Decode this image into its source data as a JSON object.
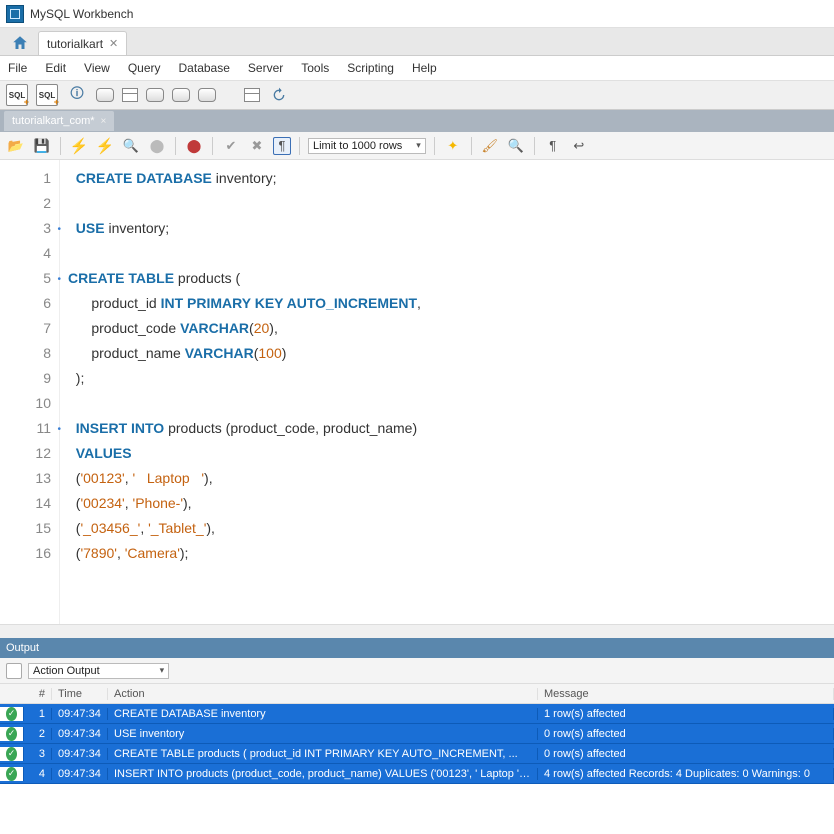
{
  "window": {
    "title": "MySQL Workbench"
  },
  "main_tab": {
    "label": "tutorialkart"
  },
  "menu": [
    "File",
    "Edit",
    "View",
    "Query",
    "Database",
    "Server",
    "Tools",
    "Scripting",
    "Help"
  ],
  "query_tab": {
    "label": "tutorialkart_com*"
  },
  "limit": "Limit to 1000 rows",
  "code": {
    "lines": [
      {
        "n": 1,
        "dot": false,
        "html": "  <span class='kw'>CREATE DATABASE</span> inventory;"
      },
      {
        "n": 2,
        "dot": false,
        "html": ""
      },
      {
        "n": 3,
        "dot": true,
        "html": "  <span class='kw'>USE</span> inventory;"
      },
      {
        "n": 4,
        "dot": false,
        "html": ""
      },
      {
        "n": 5,
        "dot": true,
        "html": "<span class='kw'>CREATE TABLE</span> products ("
      },
      {
        "n": 6,
        "dot": false,
        "html": "      product_id <span class='ty'>INT PRIMARY KEY AUTO_INCREMENT</span>,"
      },
      {
        "n": 7,
        "dot": false,
        "html": "      product_code <span class='ty'>VARCHAR</span>(<span class='num'>20</span>),"
      },
      {
        "n": 8,
        "dot": false,
        "html": "      product_name <span class='ty'>VARCHAR</span>(<span class='num'>100</span>)"
      },
      {
        "n": 9,
        "dot": false,
        "html": "  );"
      },
      {
        "n": 10,
        "dot": false,
        "html": ""
      },
      {
        "n": 11,
        "dot": true,
        "html": "  <span class='kw'>INSERT INTO</span> products (product_code, product_name)"
      },
      {
        "n": 12,
        "dot": false,
        "html": "  <span class='kw'>VALUES</span>"
      },
      {
        "n": 13,
        "dot": false,
        "html": "  (<span class='str'>'00123'</span>, <span class='str'>'   Laptop   '</span>),"
      },
      {
        "n": 14,
        "dot": false,
        "html": "  (<span class='str'>'00234'</span>, <span class='str'>'Phone-'</span>),"
      },
      {
        "n": 15,
        "dot": false,
        "html": "  (<span class='str'>'_03456_'</span>, <span class='str'>'_Tablet_'</span>),"
      },
      {
        "n": 16,
        "dot": false,
        "html": "  (<span class='str'>'7890'</span>, <span class='str'>'Camera'</span>);"
      }
    ]
  },
  "output": {
    "title": "Output",
    "combo": "Action Output",
    "headers": {
      "num": "#",
      "time": "Time",
      "action": "Action",
      "msg": "Message"
    },
    "rows": [
      {
        "n": 1,
        "time": "09:47:34",
        "action": "CREATE DATABASE inventory",
        "msg": "1 row(s) affected"
      },
      {
        "n": 2,
        "time": "09:47:34",
        "action": "USE inventory",
        "msg": "0 row(s) affected"
      },
      {
        "n": 3,
        "time": "09:47:34",
        "action": "CREATE TABLE products (     product_id INT PRIMARY KEY AUTO_INCREMENT,     ...",
        "msg": "0 row(s) affected"
      },
      {
        "n": 4,
        "time": "09:47:34",
        "action": "INSERT INTO products (product_code, product_name) VALUES ('00123', '   Laptop   '), ...",
        "msg": "4 row(s) affected Records: 4  Duplicates: 0  Warnings: 0"
      }
    ]
  }
}
